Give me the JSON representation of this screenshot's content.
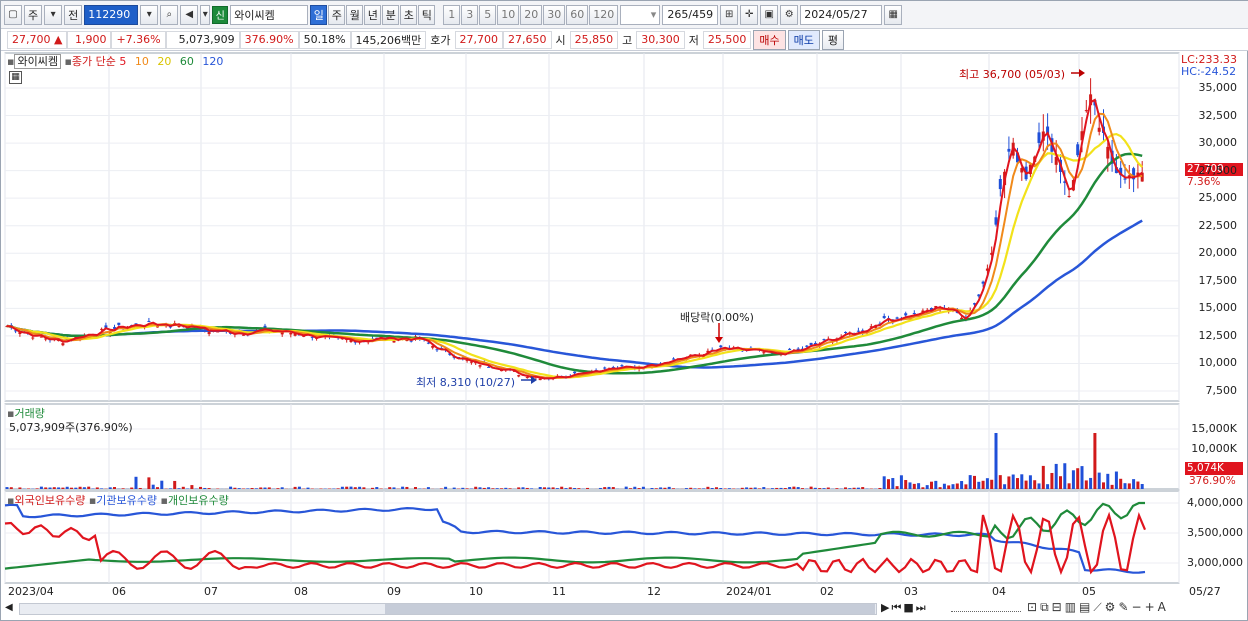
{
  "toolbar": {
    "menu_icon": "window-icon",
    "mode_label": "주",
    "prev_label": "전",
    "stock_code": "112290",
    "name_badge": "신",
    "stock_name": "와이씨켐",
    "period_tabs": [
      "일",
      "주",
      "월",
      "년",
      "분",
      "초",
      "틱"
    ],
    "active_period": "일",
    "interval_tabs": [
      "1",
      "3",
      "5",
      "10",
      "20",
      "30",
      "60",
      "120"
    ],
    "count_current": "265",
    "count_total": "459",
    "date": "2024/05/27"
  },
  "quote": {
    "price": "27,700",
    "change": "1,900",
    "change_pct": "+7.36%",
    "volume": "5,073,909",
    "volume_ratio": "376.90%",
    "turnover_pct": "50.18%",
    "amount": "145,206백만",
    "ask_label": "호가",
    "ask": "27,700",
    "bid": "27,650",
    "open_label": "시",
    "open": "25,850",
    "high_label": "고",
    "high": "30,300",
    "low_label": "저",
    "low": "25,500",
    "buy_label": "매수",
    "sell_label": "매도",
    "eval_label": "평"
  },
  "price_panel": {
    "legend_name": "와이씨켐",
    "legend_type": "종가 단순",
    "ma_labels": [
      "5",
      "10",
      "20",
      "60",
      "120"
    ],
    "lc": "LC:233.33",
    "hc": "HC:-24.52",
    "current_price_tag": "27,700",
    "current_pct_tag": "7.36%",
    "high_note": "최고 36,700 (05/03)",
    "low_note": "최저 8,310 (10/27)",
    "dividend_note": "배당락(0.00%)",
    "y_ticks": [
      "35,000",
      "32,500",
      "30,000",
      "27,500",
      "25,000",
      "22,500",
      "20,000",
      "17,500",
      "15,000",
      "12,500",
      "10,000",
      "7,500"
    ]
  },
  "volume_panel": {
    "title": "거래량",
    "value_text": "5,073,909주(376.90%)",
    "y_ticks": [
      "15,000K",
      "10,000K"
    ],
    "current_tag": "5,074K",
    "current_pct_tag": "376.90%"
  },
  "holding_panel": {
    "legend": [
      "외국인보유수량",
      "기관보유수량",
      "개인보유수량"
    ],
    "y_ticks": [
      "4,000,000",
      "3,500,000",
      "3,000,000"
    ]
  },
  "x_axis": {
    "labels": [
      "2023/04",
      "06",
      "07",
      "08",
      "09",
      "10",
      "11",
      "12",
      "2024/01",
      "02",
      "03",
      "04",
      "05",
      "05/27"
    ]
  },
  "colors": {
    "up": "#d11a1a",
    "down": "#1f4fd8",
    "ma5": "#e0141e",
    "ma10": "#f08a1a",
    "ma20": "#f2e21a",
    "ma60": "#1f8a3a",
    "ma120": "#2856d8"
  },
  "chart_data": {
    "type": "line",
    "series": [
      {
        "name": "종가",
        "x": [
          "2023/04",
          "2023/05",
          "2023/06",
          "2023/07",
          "2023/08",
          "2023/09",
          "2023/10",
          "2023/11",
          "2023/12",
          "2024/01",
          "2024/02",
          "2024/03",
          "2024/04",
          "2024/05",
          "2024/05/27"
        ],
        "values": [
          13500,
          12000,
          12500,
          13500,
          13000,
          12500,
          9000,
          9500,
          10500,
          11500,
          12000,
          14500,
          27000,
          33000,
          27700
        ]
      }
    ],
    "ylim": [
      7500,
      36700
    ]
  }
}
